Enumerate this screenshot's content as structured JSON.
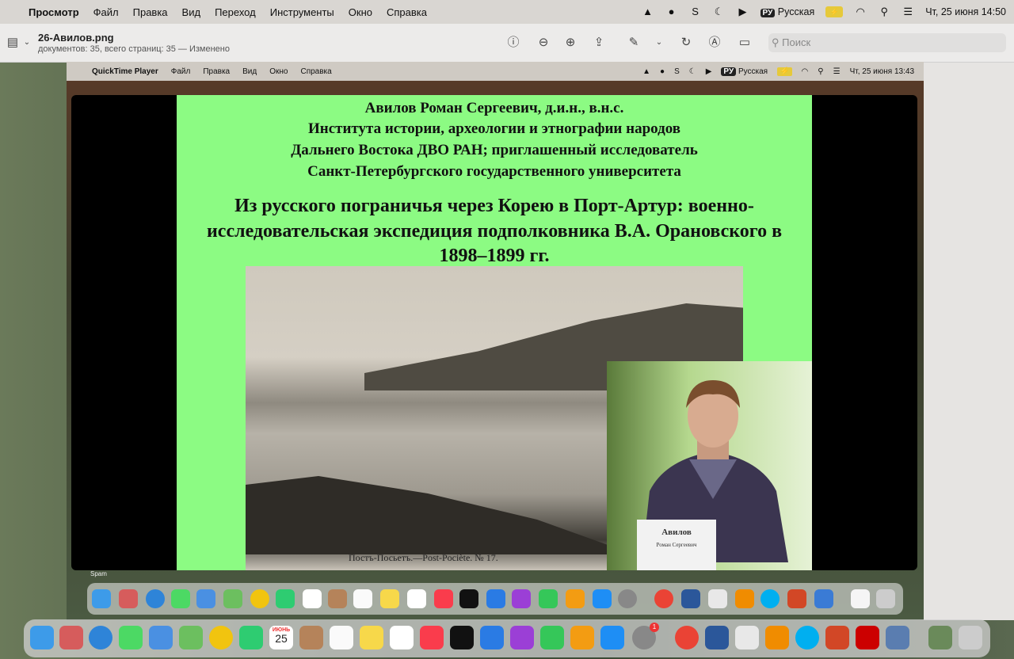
{
  "menubar": {
    "app": "Просмотр",
    "items": [
      "Файл",
      "Правка",
      "Вид",
      "Переход",
      "Инструменты",
      "Окно",
      "Справка"
    ],
    "keyboard": "РУ",
    "language": "Русская",
    "datetime": "Чт, 25 июня  14:50"
  },
  "toolbar": {
    "filename": "26-Авилов.png",
    "subtitle": "документов: 35, всего страниц: 35 — Изменено",
    "search_placeholder": "Поиск"
  },
  "inner_menubar": {
    "app": "QuickTime Player",
    "items": [
      "Файл",
      "Правка",
      "Вид",
      "Окно",
      "Справка"
    ],
    "keyboard": "РУ",
    "language": "Русская",
    "datetime": "Чт, 25 июня  13:43"
  },
  "slide": {
    "author_lines": [
      "Авилов Роман Сергеевич, д.и.н., в.н.с.",
      "Института истории, археологии и этнографии народов",
      "Дальнего Востока ДВО РАН; приглашенный исследователь",
      "Санкт-Петербургского государственного университета"
    ],
    "title_lines": [
      "Из русского пограничья через Корею в Порт-Артур: военно-",
      "исследовательская экспедиция подполковника В.А. Орановского в",
      "1898–1899 гг."
    ],
    "photo_caption": "Постъ-Посьетъ.—Post-Pociète.  № 17.",
    "nameplate_name": "Авилов",
    "nameplate_sub": "Роман Сергеевич"
  },
  "inner_dock_label": "Spam",
  "dock_calendar_month": "ИЮНЬ",
  "dock_calendar_day": "25",
  "dock_badge": "1"
}
